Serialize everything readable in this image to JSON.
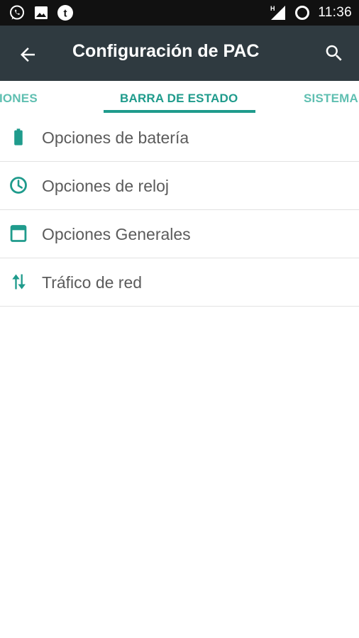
{
  "status_bar": {
    "left_icons": [
      "whatsapp-icon",
      "image-icon",
      "tumblr-icon"
    ],
    "network_label": "H",
    "time": "11:36"
  },
  "app_bar": {
    "title": "Configuración de PAC",
    "back_icon": "arrow-back-icon",
    "search_icon": "search-icon",
    "background": "#2f3a40"
  },
  "tabs": {
    "items": [
      {
        "label": "ACIONES",
        "active": false
      },
      {
        "label": "BARRA DE ESTADO",
        "active": true
      },
      {
        "label": "SISTEMA",
        "active": false
      }
    ],
    "accent": "#1f9b8c"
  },
  "list": {
    "items": [
      {
        "label": "Opciones de batería",
        "icon": "battery-icon"
      },
      {
        "label": "Opciones de reloj",
        "icon": "clock-icon"
      },
      {
        "label": "Opciones Generales",
        "icon": "window-icon"
      },
      {
        "label": "Tráfico de red",
        "icon": "network-traffic-icon"
      }
    ],
    "icon_color": "#1f9b8c"
  }
}
